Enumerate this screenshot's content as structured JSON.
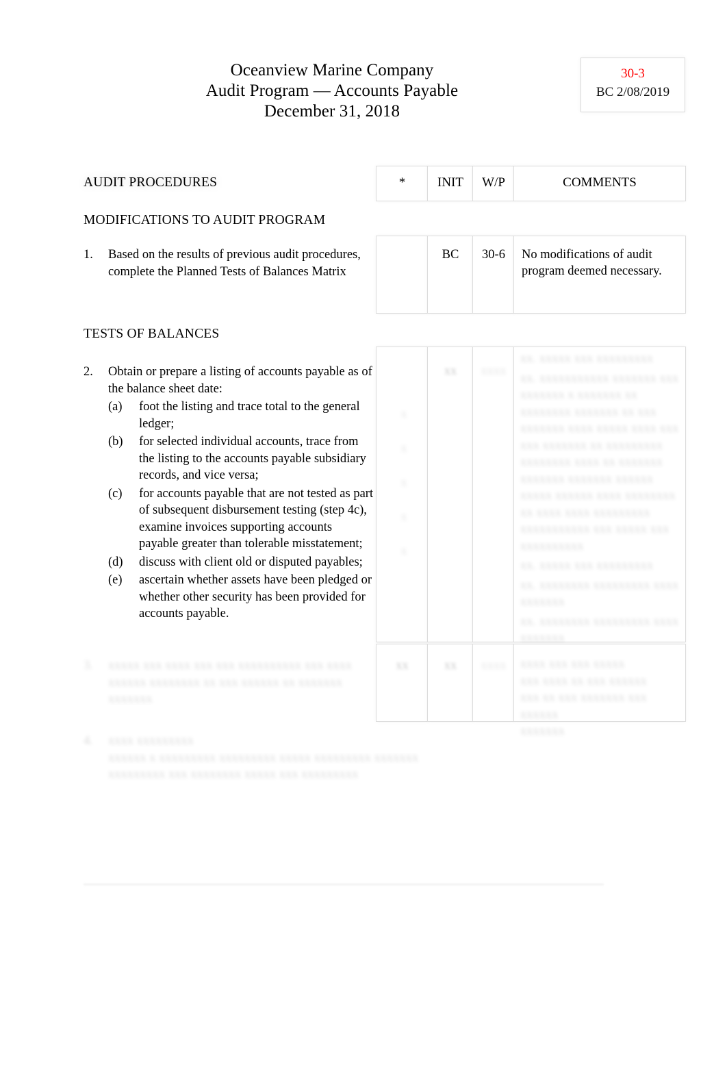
{
  "document": {
    "company": "Oceanview Marine Company",
    "subtitle": "Audit Program — Accounts Payable",
    "date_line": "December 31, 2018"
  },
  "reference_box": {
    "index": "30-3",
    "signoff": "BC  2/08/2019",
    "index_color": "#ff0000"
  },
  "table": {
    "headers": {
      "procedures": "AUDIT PROCEDURES",
      "star": "*",
      "init": "INIT",
      "wp": "W/P",
      "comments": "COMMENTS"
    },
    "sections": [
      {
        "id": "modifications",
        "title": "MODIFICATIONS TO AUDIT PROGRAM"
      },
      {
        "id": "tests",
        "title": "TESTS OF BALANCES"
      }
    ],
    "rows": [
      {
        "number": "1.",
        "text": "Based on the results of previous audit procedures, complete the Planned Tests of Balances Matrix",
        "star": "",
        "init": "BC",
        "wp": "30-6",
        "comments": "No modifications of audit program deemed necessary."
      },
      {
        "number": "2.",
        "text": "Obtain or prepare a listing of accounts payable as of the balance sheet date:",
        "subitems": [
          {
            "label": "(a)",
            "text": "foot the listing and trace total to the general ledger;"
          },
          {
            "label": "(b)",
            "text": "for selected individual accounts, trace from the listing to the accounts payable subsidiary records, and vice versa;"
          },
          {
            "label": "(c)",
            "text": "for accounts payable that are not tested as part of subsequent disbursement testing (step 4c), examine invoices supporting accounts payable greater than tolerable misstatement;"
          },
          {
            "label": "(d)",
            "text": "discuss with client old or disputed payables;"
          },
          {
            "label": "(e)",
            "text": "ascertain whether assets have been pledged or whether other security has been provided for accounts payable."
          }
        ],
        "star": "",
        "init": "",
        "wp": "",
        "comments": ""
      }
    ]
  },
  "obscured": {
    "note": "illegible",
    "row3": {
      "number": "3.",
      "line1": "xxxxx xxx xxxx xxx xxx xxxxxxxxxx",
      "line2": "xxx xxxx xxxxxx xxxxxxxx xx xxx xxxxxx xx",
      "line3": "xxxxxxx xxxxxxx"
    },
    "row4": {
      "number": "4.",
      "line1": "xxxx xxxxxxxxx",
      "line2": "xxxxxx  x   xxxxxxxxx        xxxxxxxxx    xxxxx        xxxxxxxxx      xxxxxxx",
      "line3": "xxxxxxxxx xxx xxxxxxxx          xxxxx xxx xxxxxxxxx"
    },
    "r2_star_marks": [
      "x",
      "x",
      "x",
      "x",
      "x"
    ],
    "r2_init": "xx",
    "r2_wp": "xxxx",
    "r2_comments": [
      "xx.  xxxxx  xxx xxxxxxxxx",
      "xx. xxxxxxxxxxx  xxxxxxx xxx xxxxxxx x xxxxxxx xx xxxxxxxx xxxxxxx xx xxx xxxxxxx xxxx xxxxx xxxx xxx xxx xxxxxxx xx xxxxxxxxx xxxxxxxx xxxx xx xxxxxxx xxxxxxx xxxxxxx xxxxxx xxxxx xxxxxx xxxx xxxxxxxx xx xxxx xxxx xxxxxxxxx xxxxxxxxxxx xxx xxxxx xxx xxxxxxxxxx",
      "xx.  xxxxx  xxx xxxxxxxxx",
      "xx.  xxxxxxxx xxxxxxxxx xxxx xxxxxxx",
      "xx.  xxxxxxxx xxxxxxxxx xxxx xxxxxxx"
    ],
    "r3_star": "xx",
    "r3_init": "xx",
    "r3_wp": "xxxx",
    "r3_comments": [
      "xxxx   xxx xxx xxxxx",
      "xxx xxxx xx xxx xxxxxx",
      "xxx xx   xxx xxxxxxx xxx   xxxxxx",
      "xxxxxxx"
    ]
  }
}
